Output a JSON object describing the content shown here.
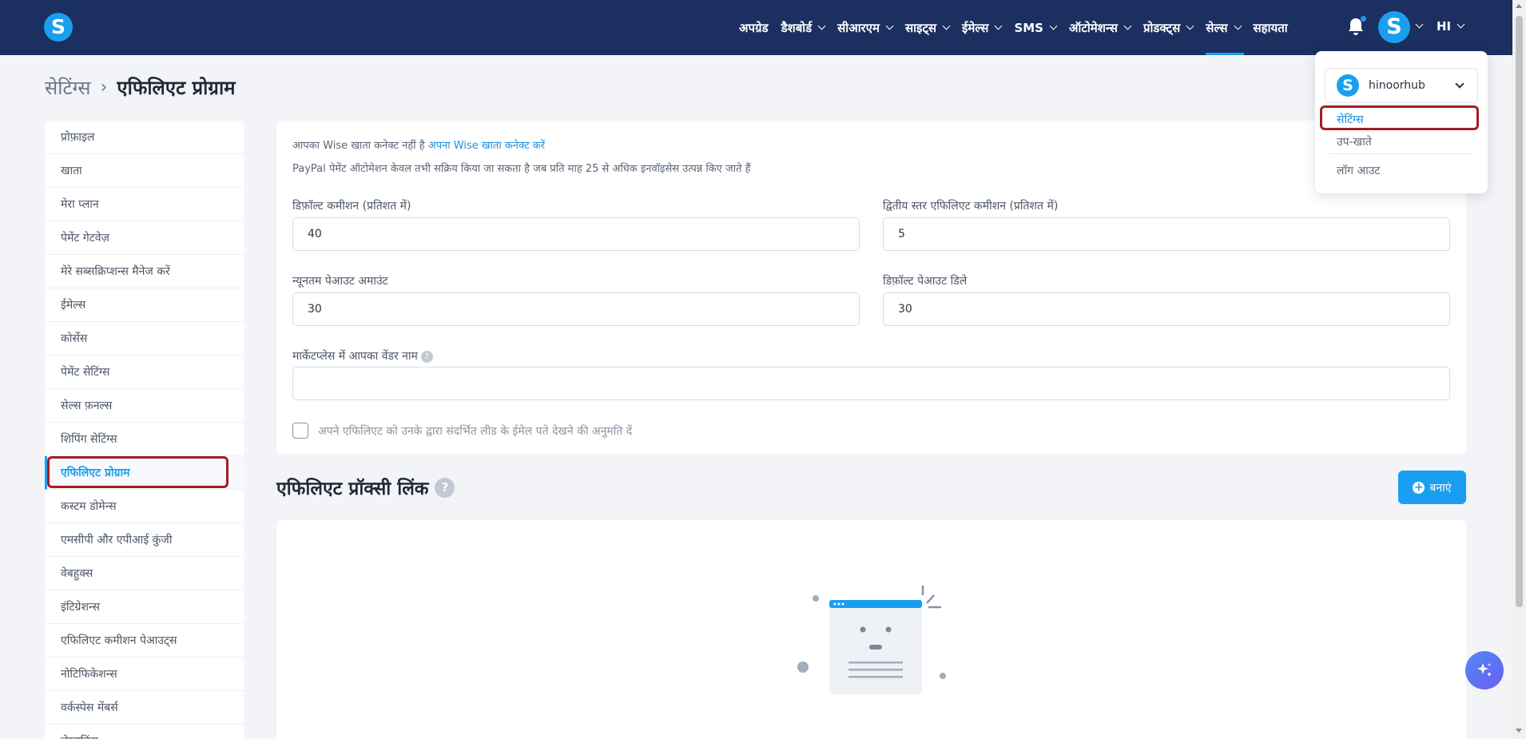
{
  "topbar": {
    "logo_letter": "S",
    "nav": [
      {
        "label": "अपग्रेड",
        "chevron": false
      },
      {
        "label": "डैशबोर्ड",
        "chevron": true
      },
      {
        "label": "सीआरएम",
        "chevron": true
      },
      {
        "label": "साइट्स",
        "chevron": true
      },
      {
        "label": "ईमेल्स",
        "chevron": true
      },
      {
        "label": "SMS",
        "chevron": true
      },
      {
        "label": "ऑटोमेशन्स",
        "chevron": true
      },
      {
        "label": "प्रोडक्ट्स",
        "chevron": true
      },
      {
        "label": "सेल्स",
        "chevron": true,
        "active": true
      },
      {
        "label": "सहायता",
        "chevron": false
      }
    ],
    "avatar_letter": "S",
    "user_label": "HI"
  },
  "breadcrumb": {
    "parent": "सेटिंग्स",
    "separator": "›",
    "current": "एफिलिएट प्रोग्राम"
  },
  "sidebar": {
    "items": [
      {
        "label": "प्रोफ़ाइल"
      },
      {
        "label": "खाता"
      },
      {
        "label": "मेरा प्लान"
      },
      {
        "label": "पेमेंट गेटवेज़"
      },
      {
        "label": "मेरे सब्सक्रिप्शन्स मैनेज करें"
      },
      {
        "label": "ईमेल्स"
      },
      {
        "label": "कोर्सेस"
      },
      {
        "label": "पेमेंट सेटिंग्स"
      },
      {
        "label": "सेल्स फ़नल्स"
      },
      {
        "label": "शिपिंग सेटिंग्स"
      },
      {
        "label": "एफिलिएट प्रोग्राम",
        "active": true
      },
      {
        "label": "कस्टम डोमेन्स"
      },
      {
        "label": "एमसीपी और एपीआई कुंजी"
      },
      {
        "label": "वेबहुक्स"
      },
      {
        "label": "इंटिग्रेशन्स"
      },
      {
        "label": "एफिलिएट कमीशन पेआउट्स"
      },
      {
        "label": "नोटिफिकेशन्स"
      },
      {
        "label": "वर्कस्पेस मेंबर्स"
      },
      {
        "label": "लेखाकिंग"
      }
    ]
  },
  "settings": {
    "wise_notice": "आपका Wise खाता कनेक्ट नहीं है",
    "wise_link": "अपना Wise खाता कनेक्ट करें",
    "paypal_notice": "PayPal पेमेंट ऑटोमेशन केवल तभी सक्रिय किया जा सकता है जब प्रति माह 25 से अधिक इनवॉइसेस उत्पन्न किए जाते हैं",
    "default_commission_label": "डिफ़ॉल्ट कमीशन (प्रतिशत में)",
    "default_commission_value": "40",
    "second_tier_label": "द्वितीय स्तर एफिलिएट कमीशन (प्रतिशत में)",
    "second_tier_value": "5",
    "min_payout_label": "न्यूनतम पेआउट अमाउंट",
    "min_payout_value": "30",
    "payout_delay_label": "डिफ़ॉल्ट पेआउट डिले",
    "payout_delay_value": "30",
    "vendor_name_label": "मार्केटप्लेस में आपका वेंडर नाम",
    "vendor_name_value": "",
    "help_glyph": "?",
    "allow_email_label": "अपने एफिलिएट को उनके द्वारा संदर्भित लीड के ईमेल पते देखने की अनुमति दें",
    "allow_email_checked": false
  },
  "proxy": {
    "title": "एफिलिएट प्रॉक्सी लिंक",
    "help_glyph": "?",
    "create_label": "बनाएं",
    "create_icon": "+"
  },
  "dropdown": {
    "account_letter": "S",
    "account_name": "hinoorhub",
    "items": [
      {
        "label": "सेटिंग्स",
        "active": true
      },
      {
        "label": "उप-खाते"
      },
      {
        "label": "लॉग आउट"
      }
    ]
  },
  "colors": {
    "topbar": "#1b2f60",
    "accent": "#1a9ff0",
    "highlight_border": "#a51d24"
  }
}
